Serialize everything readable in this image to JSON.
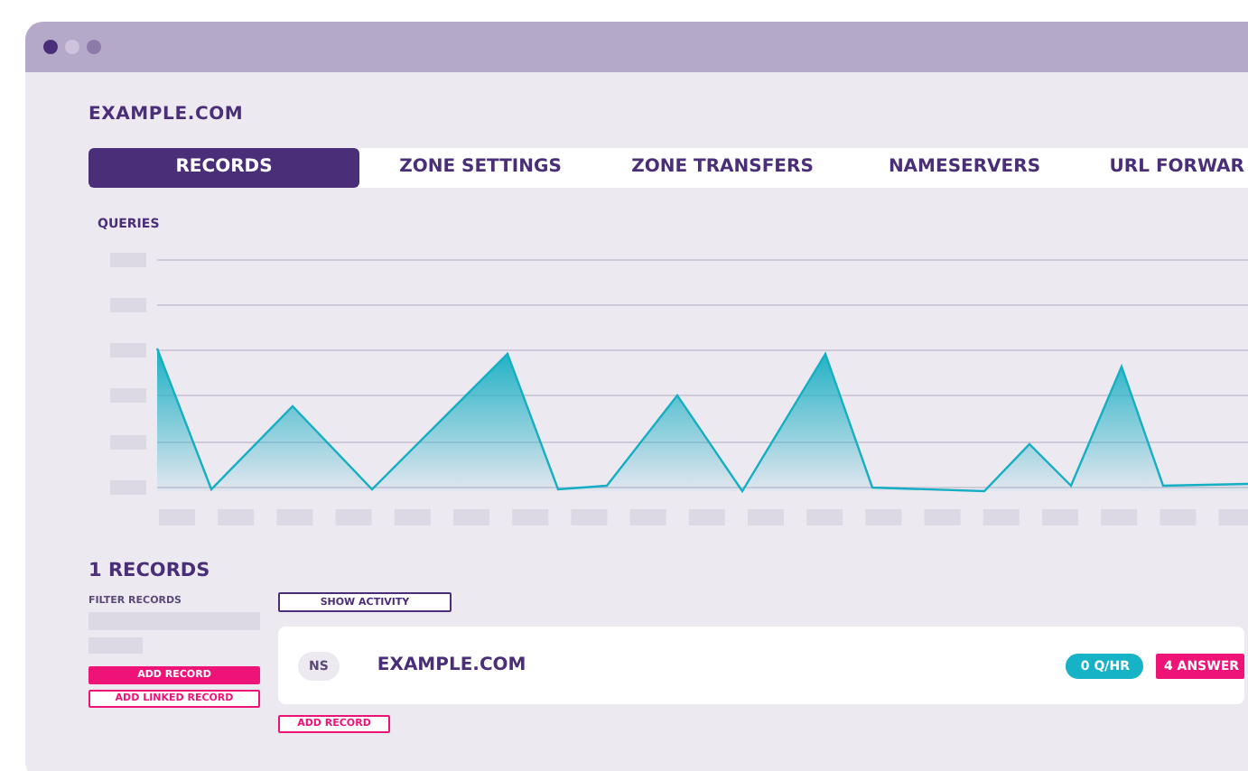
{
  "domain": "EXAMPLE.COM",
  "tabs": [
    {
      "label": "RECORDS",
      "selected": true
    },
    {
      "label": "ZONE SETTINGS",
      "selected": false
    },
    {
      "label": "ZONE TRANSFERS",
      "selected": false
    },
    {
      "label": "NAMESERVERS",
      "selected": false
    },
    {
      "label": "URL FORWAR",
      "selected": false
    }
  ],
  "chart": {
    "label": "QUERIES"
  },
  "records": {
    "heading": "1 RECORDS",
    "filter_label": "FILTER RECORDS",
    "buttons": [
      {
        "label": "ADD RECORD",
        "kind": "filled"
      },
      {
        "label": "ADD LINKED RECORD",
        "kind": "outline"
      }
    ],
    "show_activity": "SHOW ACTIVITY",
    "rows": [
      {
        "type": "NS",
        "name": "EXAMPLE.COM",
        "queries": "0 Q/HR",
        "answers": "4 ANSWER"
      }
    ],
    "add_record": "ADD RECORD"
  }
}
